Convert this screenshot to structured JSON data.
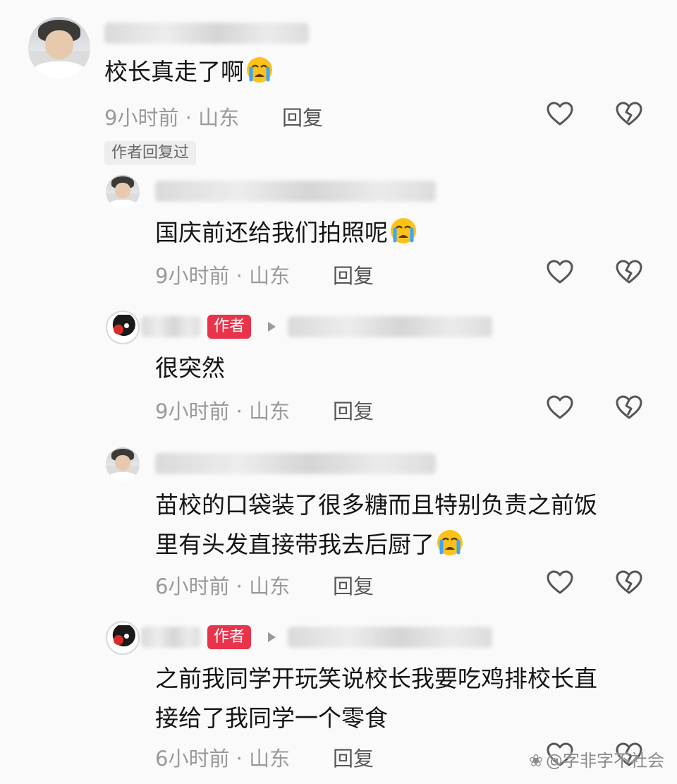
{
  "comments": [
    {
      "text": "校长真走了啊",
      "emoji": "loudly-crying-face",
      "time": "9小时前",
      "sep": "·",
      "location": "山东",
      "reply_label": "回复",
      "author_replied_label": "作者回复过"
    },
    {
      "text": "国庆前还给我们拍照呢",
      "emoji": "loudly-crying-face",
      "time": "9小时前",
      "sep": "·",
      "location": "山东",
      "reply_label": "回复"
    },
    {
      "author_tag": "作者",
      "text": "很突然",
      "time": "9小时前",
      "sep": "·",
      "location": "山东",
      "reply_label": "回复"
    },
    {
      "text_line1": "苗校的口袋装了很多糖而且特别负责之前饭",
      "text_line2": "里有头发直接带我去后厨了",
      "emoji": "loudly-crying-face",
      "time": "6小时前",
      "sep": "·",
      "location": "山东",
      "reply_label": "回复"
    },
    {
      "author_tag": "作者",
      "text_line1": "之前我同学开玩笑说校长我要吃鸡排校长直",
      "text_line2": "接给了我同学一个零食",
      "time": "6小时前",
      "sep": "·",
      "location": "山东",
      "reply_label": "回复"
    }
  ],
  "icons": {
    "like": "heart-outline-icon",
    "dislike": "broken-heart-icon",
    "reply_arrow": "triangle-right-icon"
  },
  "colors": {
    "author_tag": "#e8334a",
    "meta_text": "#9a9a9a",
    "body_text": "#141414"
  },
  "watermark": "@字非字不社会"
}
